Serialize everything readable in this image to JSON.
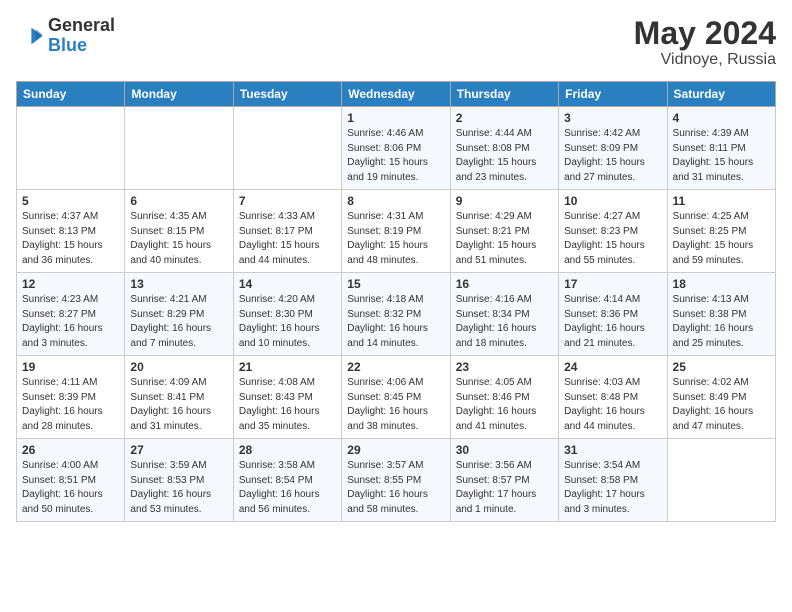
{
  "header": {
    "logo_line1": "General",
    "logo_line2": "Blue",
    "month": "May 2024",
    "location": "Vidnoye, Russia"
  },
  "days_of_week": [
    "Sunday",
    "Monday",
    "Tuesday",
    "Wednesday",
    "Thursday",
    "Friday",
    "Saturday"
  ],
  "weeks": [
    [
      {
        "day": "",
        "info": ""
      },
      {
        "day": "",
        "info": ""
      },
      {
        "day": "",
        "info": ""
      },
      {
        "day": "1",
        "info": "Sunrise: 4:46 AM\nSunset: 8:06 PM\nDaylight: 15 hours\nand 19 minutes."
      },
      {
        "day": "2",
        "info": "Sunrise: 4:44 AM\nSunset: 8:08 PM\nDaylight: 15 hours\nand 23 minutes."
      },
      {
        "day": "3",
        "info": "Sunrise: 4:42 AM\nSunset: 8:09 PM\nDaylight: 15 hours\nand 27 minutes."
      },
      {
        "day": "4",
        "info": "Sunrise: 4:39 AM\nSunset: 8:11 PM\nDaylight: 15 hours\nand 31 minutes."
      }
    ],
    [
      {
        "day": "5",
        "info": "Sunrise: 4:37 AM\nSunset: 8:13 PM\nDaylight: 15 hours\nand 36 minutes."
      },
      {
        "day": "6",
        "info": "Sunrise: 4:35 AM\nSunset: 8:15 PM\nDaylight: 15 hours\nand 40 minutes."
      },
      {
        "day": "7",
        "info": "Sunrise: 4:33 AM\nSunset: 8:17 PM\nDaylight: 15 hours\nand 44 minutes."
      },
      {
        "day": "8",
        "info": "Sunrise: 4:31 AM\nSunset: 8:19 PM\nDaylight: 15 hours\nand 48 minutes."
      },
      {
        "day": "9",
        "info": "Sunrise: 4:29 AM\nSunset: 8:21 PM\nDaylight: 15 hours\nand 51 minutes."
      },
      {
        "day": "10",
        "info": "Sunrise: 4:27 AM\nSunset: 8:23 PM\nDaylight: 15 hours\nand 55 minutes."
      },
      {
        "day": "11",
        "info": "Sunrise: 4:25 AM\nSunset: 8:25 PM\nDaylight: 15 hours\nand 59 minutes."
      }
    ],
    [
      {
        "day": "12",
        "info": "Sunrise: 4:23 AM\nSunset: 8:27 PM\nDaylight: 16 hours\nand 3 minutes."
      },
      {
        "day": "13",
        "info": "Sunrise: 4:21 AM\nSunset: 8:29 PM\nDaylight: 16 hours\nand 7 minutes."
      },
      {
        "day": "14",
        "info": "Sunrise: 4:20 AM\nSunset: 8:30 PM\nDaylight: 16 hours\nand 10 minutes."
      },
      {
        "day": "15",
        "info": "Sunrise: 4:18 AM\nSunset: 8:32 PM\nDaylight: 16 hours\nand 14 minutes."
      },
      {
        "day": "16",
        "info": "Sunrise: 4:16 AM\nSunset: 8:34 PM\nDaylight: 16 hours\nand 18 minutes."
      },
      {
        "day": "17",
        "info": "Sunrise: 4:14 AM\nSunset: 8:36 PM\nDaylight: 16 hours\nand 21 minutes."
      },
      {
        "day": "18",
        "info": "Sunrise: 4:13 AM\nSunset: 8:38 PM\nDaylight: 16 hours\nand 25 minutes."
      }
    ],
    [
      {
        "day": "19",
        "info": "Sunrise: 4:11 AM\nSunset: 8:39 PM\nDaylight: 16 hours\nand 28 minutes."
      },
      {
        "day": "20",
        "info": "Sunrise: 4:09 AM\nSunset: 8:41 PM\nDaylight: 16 hours\nand 31 minutes."
      },
      {
        "day": "21",
        "info": "Sunrise: 4:08 AM\nSunset: 8:43 PM\nDaylight: 16 hours\nand 35 minutes."
      },
      {
        "day": "22",
        "info": "Sunrise: 4:06 AM\nSunset: 8:45 PM\nDaylight: 16 hours\nand 38 minutes."
      },
      {
        "day": "23",
        "info": "Sunrise: 4:05 AM\nSunset: 8:46 PM\nDaylight: 16 hours\nand 41 minutes."
      },
      {
        "day": "24",
        "info": "Sunrise: 4:03 AM\nSunset: 8:48 PM\nDaylight: 16 hours\nand 44 minutes."
      },
      {
        "day": "25",
        "info": "Sunrise: 4:02 AM\nSunset: 8:49 PM\nDaylight: 16 hours\nand 47 minutes."
      }
    ],
    [
      {
        "day": "26",
        "info": "Sunrise: 4:00 AM\nSunset: 8:51 PM\nDaylight: 16 hours\nand 50 minutes."
      },
      {
        "day": "27",
        "info": "Sunrise: 3:59 AM\nSunset: 8:53 PM\nDaylight: 16 hours\nand 53 minutes."
      },
      {
        "day": "28",
        "info": "Sunrise: 3:58 AM\nSunset: 8:54 PM\nDaylight: 16 hours\nand 56 minutes."
      },
      {
        "day": "29",
        "info": "Sunrise: 3:57 AM\nSunset: 8:55 PM\nDaylight: 16 hours\nand 58 minutes."
      },
      {
        "day": "30",
        "info": "Sunrise: 3:56 AM\nSunset: 8:57 PM\nDaylight: 17 hours\nand 1 minute."
      },
      {
        "day": "31",
        "info": "Sunrise: 3:54 AM\nSunset: 8:58 PM\nDaylight: 17 hours\nand 3 minutes."
      },
      {
        "day": "",
        "info": ""
      }
    ]
  ]
}
